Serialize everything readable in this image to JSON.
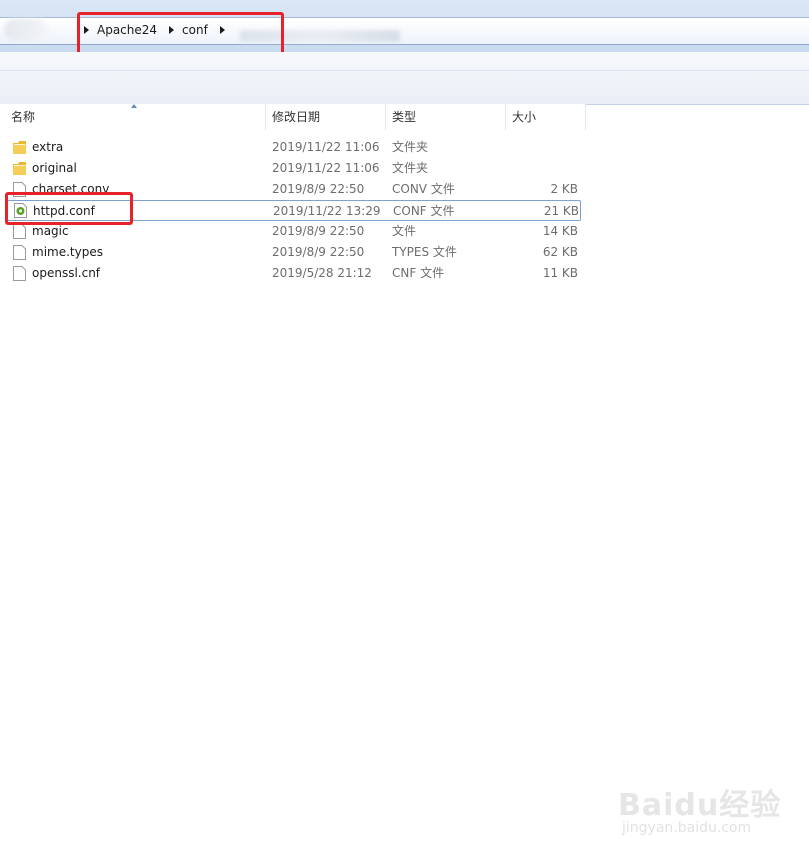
{
  "address": {
    "crumbs": [
      "Apache24",
      "conf"
    ]
  },
  "columns": {
    "name": "名称",
    "date": "修改日期",
    "type": "类型",
    "size": "大小"
  },
  "files": [
    {
      "name": "extra",
      "date": "2019/11/22 11:06",
      "type": "文件夹",
      "size": "",
      "icon": "folder-icon"
    },
    {
      "name": "original",
      "date": "2019/11/22 11:06",
      "type": "文件夹",
      "size": "",
      "icon": "folder-icon"
    },
    {
      "name": "charset.conv",
      "date": "2019/8/9 22:50",
      "type": "CONV 文件",
      "size": "2 KB",
      "icon": "file-icon"
    },
    {
      "name": "httpd.conf",
      "date": "2019/11/22 13:29",
      "type": "CONF 文件",
      "size": "21 KB",
      "icon": "conf-file-icon"
    },
    {
      "name": "magic",
      "date": "2019/8/9 22:50",
      "type": "文件",
      "size": "14 KB",
      "icon": "file-icon"
    },
    {
      "name": "mime.types",
      "date": "2019/8/9 22:50",
      "type": "TYPES 文件",
      "size": "62 KB",
      "icon": "file-icon"
    },
    {
      "name": "openssl.cnf",
      "date": "2019/5/28 21:12",
      "type": "CNF 文件",
      "size": "11 KB",
      "icon": "file-icon"
    }
  ],
  "watermark": {
    "brand": "Baidu经验",
    "url": "jingyan.baidu.com"
  },
  "colors": {
    "highlight": "#e8222b",
    "selection_border": "#7da2ce",
    "folder": "#e8b830"
  }
}
